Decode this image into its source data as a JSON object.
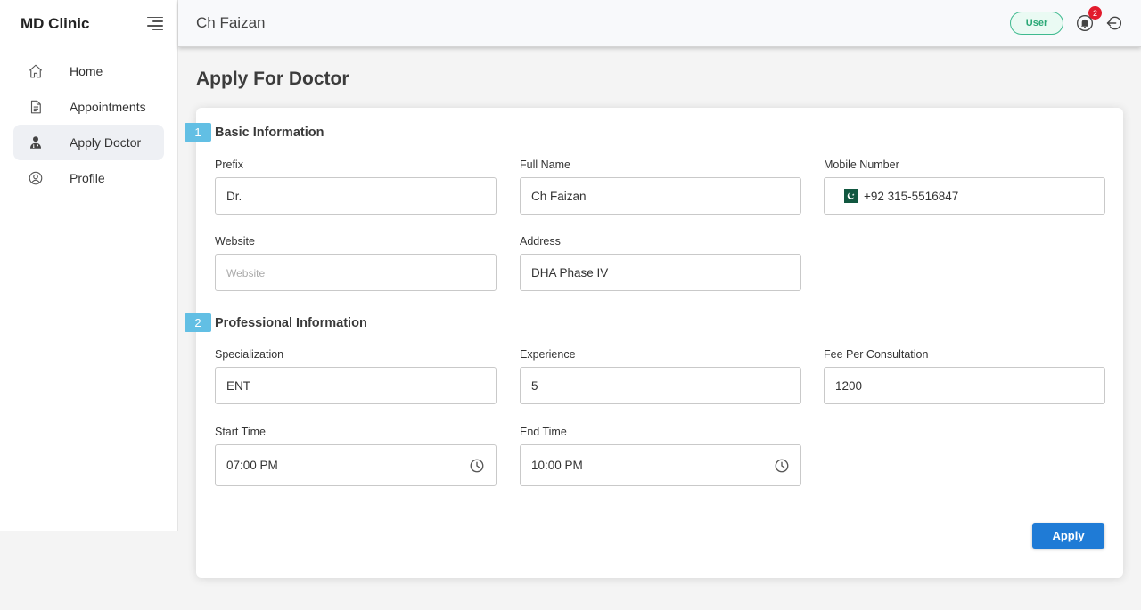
{
  "app": {
    "brand": "MD Clinic"
  },
  "sidebar": {
    "items": [
      {
        "label": "Home",
        "icon": "home-icon",
        "active": false
      },
      {
        "label": "Appointments",
        "icon": "document-icon",
        "active": false
      },
      {
        "label": "Apply Doctor",
        "icon": "doctor-icon",
        "active": true
      },
      {
        "label": "Profile",
        "icon": "user-circle-icon",
        "active": false
      }
    ]
  },
  "header": {
    "title": "Ch Faizan",
    "role_badge": "User",
    "notification_count": "2",
    "accent_color": "#3fba8f"
  },
  "main": {
    "page_title": "Apply For Doctor",
    "sections": [
      {
        "number": "1",
        "title": "Basic Information"
      },
      {
        "number": "2",
        "title": "Professional Information"
      }
    ],
    "fields": {
      "prefix": {
        "label": "Prefix",
        "value": "Dr."
      },
      "full_name": {
        "label": "Full Name",
        "value": "Ch Faizan"
      },
      "mobile": {
        "label": "Mobile Number",
        "value": "+92 315-5516847",
        "flag": "pakistan-flag-icon"
      },
      "website": {
        "label": "Website",
        "value": "",
        "placeholder": "Website"
      },
      "address": {
        "label": "Address",
        "value": "DHA Phase IV"
      },
      "specialization": {
        "label": "Specialization",
        "value": "ENT"
      },
      "experience": {
        "label": "Experience",
        "value": "5"
      },
      "fee": {
        "label": "Fee Per Consultation",
        "value": "1200"
      },
      "start_time": {
        "label": "Start Time",
        "value": "07:00 PM"
      },
      "end_time": {
        "label": "End Time",
        "value": "10:00 PM"
      }
    },
    "apply_button": "Apply",
    "button_color": "#1f7bd6"
  }
}
